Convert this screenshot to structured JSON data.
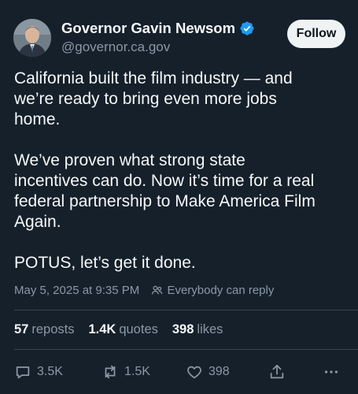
{
  "author": {
    "display_name": "Governor Gavin Newsom",
    "handle": "@governor.ca.gov",
    "verified": true
  },
  "follow_button": {
    "label": "Follow"
  },
  "post": {
    "paragraphs": [
      "California built the film industry — and\nwe’re ready to bring even more jobs\nhome.",
      "We’ve proven what strong state\nincentives can do. Now it’s time for a real\nfederal partnership to Make America Film\nAgain.",
      "POTUS, let’s get it done."
    ],
    "timestamp": "May 5, 2025 at 9:35 PM",
    "reply_setting": "Everybody can reply"
  },
  "stats": {
    "reposts": {
      "count": "57",
      "label": "reposts"
    },
    "quotes": {
      "count": "1.4K",
      "label": "quotes"
    },
    "likes": {
      "count": "398",
      "label": "likes"
    }
  },
  "actions": {
    "reply_count": "3.5K",
    "repost_count": "1.5K",
    "like_count": "398"
  },
  "colors": {
    "background": "#15202b",
    "text_primary": "#f7f9f9",
    "text_secondary": "#8b98a5",
    "verified_blue": "#1d9bf0",
    "follow_bg": "#eff3f4"
  },
  "icons": [
    "verified-badge-icon",
    "people-icon",
    "reply-icon",
    "repost-icon",
    "like-icon",
    "share-icon",
    "more-icon"
  ]
}
